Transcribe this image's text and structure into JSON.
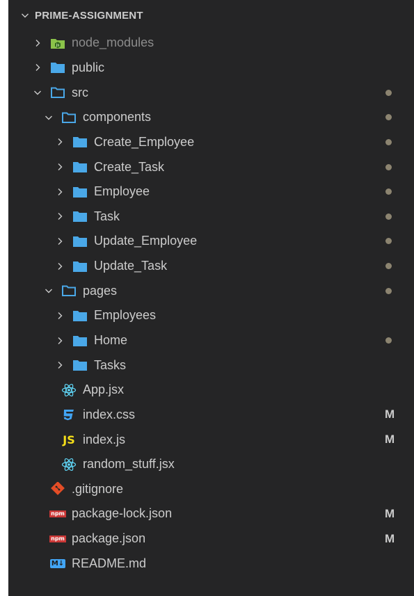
{
  "explorer": {
    "title": "PRIME-ASSIGNMENT",
    "colors": {
      "background": "#252526",
      "text": "#cccccc",
      "dim_text": "#8c8c8c",
      "folder_blue": "#4aa8e8",
      "node_green": "#8bc34a",
      "git_orange": "#e44d26",
      "npm_red": "#cb3837",
      "react_blue": "#61dafb",
      "css_blue": "#42a5f5",
      "js_yellow": "#f5de19",
      "md_blue": "#42a5f5",
      "modified_dot": "#8c8470"
    },
    "items": [
      {
        "label": "node_modules",
        "icon": "node-modules-folder-icon",
        "expanded": false,
        "dim": true,
        "dot": false,
        "status": ""
      },
      {
        "label": "public",
        "icon": "folder-icon",
        "expanded": false,
        "dim": false,
        "dot": false,
        "status": ""
      },
      {
        "label": "src",
        "icon": "folder-open-icon",
        "expanded": true,
        "dim": false,
        "dot": true,
        "status": ""
      },
      {
        "label": "components",
        "icon": "folder-open-icon",
        "expanded": true,
        "dim": false,
        "dot": true,
        "status": ""
      },
      {
        "label": "Create_Employee",
        "icon": "folder-icon",
        "expanded": false,
        "dim": false,
        "dot": true,
        "status": ""
      },
      {
        "label": "Create_Task",
        "icon": "folder-icon",
        "expanded": false,
        "dim": false,
        "dot": true,
        "status": ""
      },
      {
        "label": "Employee",
        "icon": "folder-icon",
        "expanded": false,
        "dim": false,
        "dot": true,
        "status": ""
      },
      {
        "label": "Task",
        "icon": "folder-icon",
        "expanded": false,
        "dim": false,
        "dot": true,
        "status": ""
      },
      {
        "label": "Update_Employee",
        "icon": "folder-icon",
        "expanded": false,
        "dim": false,
        "dot": true,
        "status": ""
      },
      {
        "label": "Update_Task",
        "icon": "folder-icon",
        "expanded": false,
        "dim": false,
        "dot": true,
        "status": ""
      },
      {
        "label": "pages",
        "icon": "folder-open-icon",
        "expanded": true,
        "dim": false,
        "dot": true,
        "status": ""
      },
      {
        "label": "Employees",
        "icon": "folder-icon",
        "expanded": false,
        "dim": false,
        "dot": false,
        "status": ""
      },
      {
        "label": "Home",
        "icon": "folder-icon",
        "expanded": false,
        "dim": false,
        "dot": true,
        "status": ""
      },
      {
        "label": "Tasks",
        "icon": "folder-icon",
        "expanded": false,
        "dim": false,
        "dot": false,
        "status": ""
      },
      {
        "label": "App.jsx",
        "icon": "react-icon",
        "dim": false,
        "dot": false,
        "status": ""
      },
      {
        "label": "index.css",
        "icon": "css-icon",
        "dim": false,
        "dot": false,
        "status": "M"
      },
      {
        "label": "index.js",
        "icon": "js-icon",
        "dim": false,
        "dot": false,
        "status": "M"
      },
      {
        "label": "random_stuff.jsx",
        "icon": "react-icon",
        "dim": false,
        "dot": false,
        "status": ""
      },
      {
        "label": ".gitignore",
        "icon": "git-icon",
        "dim": false,
        "dot": false,
        "status": ""
      },
      {
        "label": "package-lock.json",
        "icon": "npm-icon",
        "dim": false,
        "dot": false,
        "status": "M"
      },
      {
        "label": "package.json",
        "icon": "npm-icon",
        "dim": false,
        "dot": false,
        "status": "M"
      },
      {
        "label": "README.md",
        "icon": "markdown-icon",
        "dim": false,
        "dot": false,
        "status": ""
      }
    ],
    "js_badge_text": "JS",
    "npm_badge_text": "npm",
    "md_badge_text": "M↓"
  }
}
